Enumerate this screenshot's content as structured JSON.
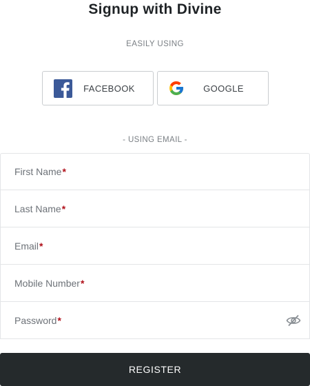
{
  "header": {
    "title": "Signup with Divine",
    "subtitle": "EASILY USING"
  },
  "social": [
    {
      "label": "FACEBOOK",
      "icon": "facebook-icon",
      "color": "#3b5998"
    },
    {
      "label": "GOOGLE",
      "icon": "google-icon"
    }
  ],
  "divider": {
    "label": "- USING EMAIL -"
  },
  "form": {
    "fields": [
      {
        "label": "First Name",
        "required": "*"
      },
      {
        "label": "Last Name",
        "required": "*"
      },
      {
        "label": "Email",
        "required": "*"
      },
      {
        "label": "Mobile Number",
        "required": "*"
      },
      {
        "label": "Password",
        "required": "*",
        "icon": "eye-off-icon"
      }
    ],
    "submit_label": "REGISTER"
  },
  "colors": {
    "required": "#b0101a",
    "button_bg": "#252a2c",
    "facebook": "#3b5998"
  }
}
